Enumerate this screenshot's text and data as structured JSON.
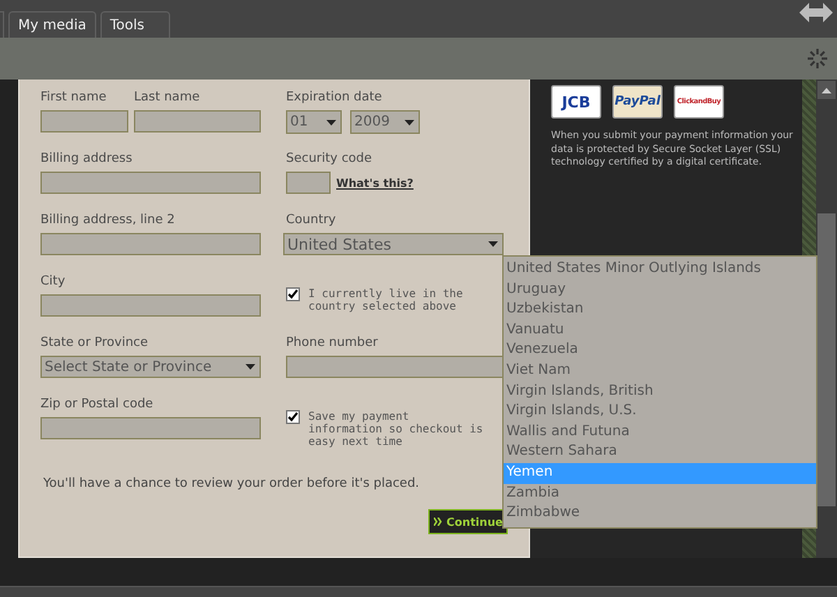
{
  "tabs": [
    {
      "label": "My media"
    },
    {
      "label": "Tools"
    }
  ],
  "form": {
    "first_name": {
      "label": "First name"
    },
    "last_name": {
      "label": "Last name"
    },
    "expiration": {
      "label": "Expiration date",
      "month": "01",
      "year": "2009"
    },
    "billing_address": {
      "label": "Billing address"
    },
    "security_code": {
      "label": "Security code",
      "link": "What's this?"
    },
    "billing_address_2": {
      "label": "Billing address, line 2"
    },
    "country": {
      "label": "Country",
      "value": "United States"
    },
    "city": {
      "label": "City"
    },
    "live_in_country": {
      "label": "I currently live in the country selected above",
      "checked": true
    },
    "state": {
      "label": "State or Province",
      "value": "Select State or Province"
    },
    "phone": {
      "label": "Phone number"
    },
    "zip": {
      "label": "Zip or Postal code"
    },
    "save_payment": {
      "label": "Save my payment information so checkout is easy next time",
      "checked": true
    },
    "note": "You'll have a chance to review your order before it's placed.",
    "continue": "Continue"
  },
  "payment_logos": [
    "JCB",
    "PayPal",
    "ClickandBuy"
  ],
  "security_text": "When you submit your payment information your data is protected by Secure Socket Layer (SSL) technology certified by a digital certificate.",
  "country_list": [
    {
      "name": "United States Minor Outlying Islands",
      "selected": false
    },
    {
      "name": "Uruguay",
      "selected": false
    },
    {
      "name": "Uzbekistan",
      "selected": false
    },
    {
      "name": "Vanuatu",
      "selected": false
    },
    {
      "name": "Venezuela",
      "selected": false
    },
    {
      "name": "Viet Nam",
      "selected": false
    },
    {
      "name": "Virgin Islands, British",
      "selected": false
    },
    {
      "name": "Virgin Islands, U.S.",
      "selected": false
    },
    {
      "name": "Wallis and Futuna",
      "selected": false
    },
    {
      "name": "Western Sahara",
      "selected": false
    },
    {
      "name": "Yemen",
      "selected": true
    },
    {
      "name": "Zambia",
      "selected": false
    },
    {
      "name": "Zimbabwe",
      "selected": false
    }
  ]
}
